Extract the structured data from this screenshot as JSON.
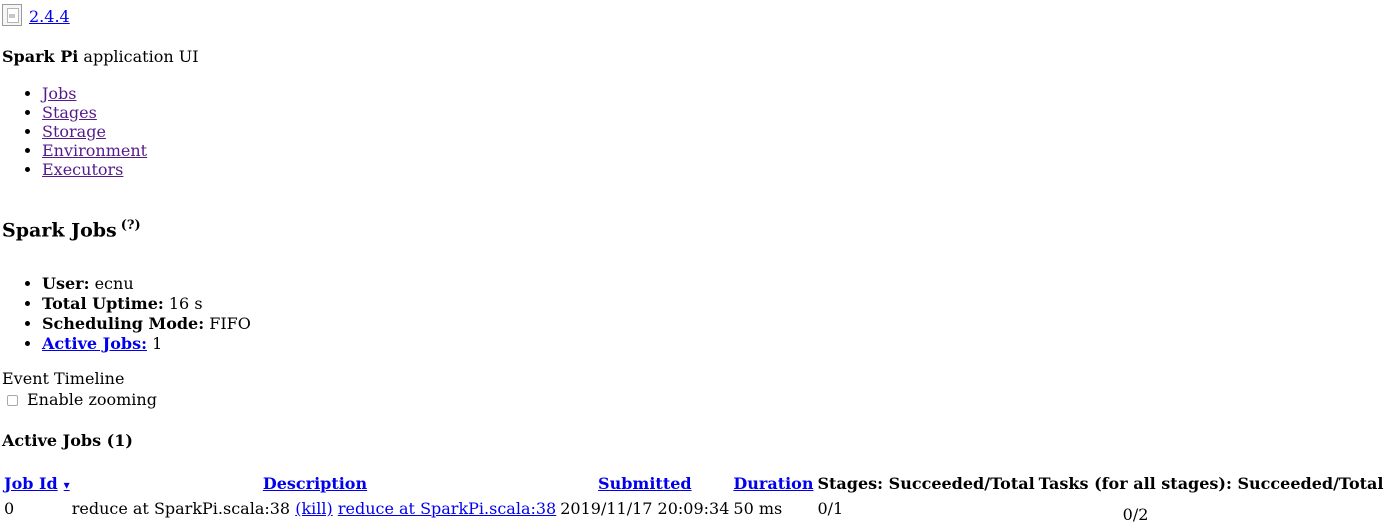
{
  "brand": {
    "logo_icon": "spark-logo-broken-image-icon",
    "version": "2.4.4"
  },
  "app": {
    "name": "Spark Pi",
    "suffix": "application UI"
  },
  "nav": {
    "items": [
      {
        "label": "Jobs"
      },
      {
        "label": "Stages"
      },
      {
        "label": "Storage"
      },
      {
        "label": "Environment"
      },
      {
        "label": "Executors"
      }
    ]
  },
  "page": {
    "title": "Spark Jobs",
    "help": "(?)"
  },
  "summary": {
    "user_label": "User:",
    "user_value": "ecnu",
    "uptime_label": "Total Uptime:",
    "uptime_value": "16 s",
    "scheduling_label": "Scheduling Mode:",
    "scheduling_value": "FIFO",
    "active_jobs_label": "Active Jobs:",
    "active_jobs_value": "1"
  },
  "timeline": {
    "label": "Event Timeline",
    "zoom_label": "Enable zooming",
    "zoom_checked": false
  },
  "active_jobs": {
    "title": "Active Jobs (1)",
    "columns": {
      "job_id": "Job Id",
      "sort_arrow": "▾",
      "description": "Description",
      "submitted": "Submitted",
      "duration": "Duration",
      "stages": "Stages: Succeeded/Total",
      "tasks": "Tasks (for all stages): Succeeded/Total"
    },
    "rows": [
      {
        "job_id": "0",
        "description_text": "reduce at SparkPi.scala:38",
        "kill_label": "(kill)",
        "description_link": "reduce at SparkPi.scala:38",
        "submitted": "2019/11/17 20:09:34",
        "duration": "50 ms",
        "stages": "0/1",
        "tasks": "0/2"
      }
    ]
  }
}
